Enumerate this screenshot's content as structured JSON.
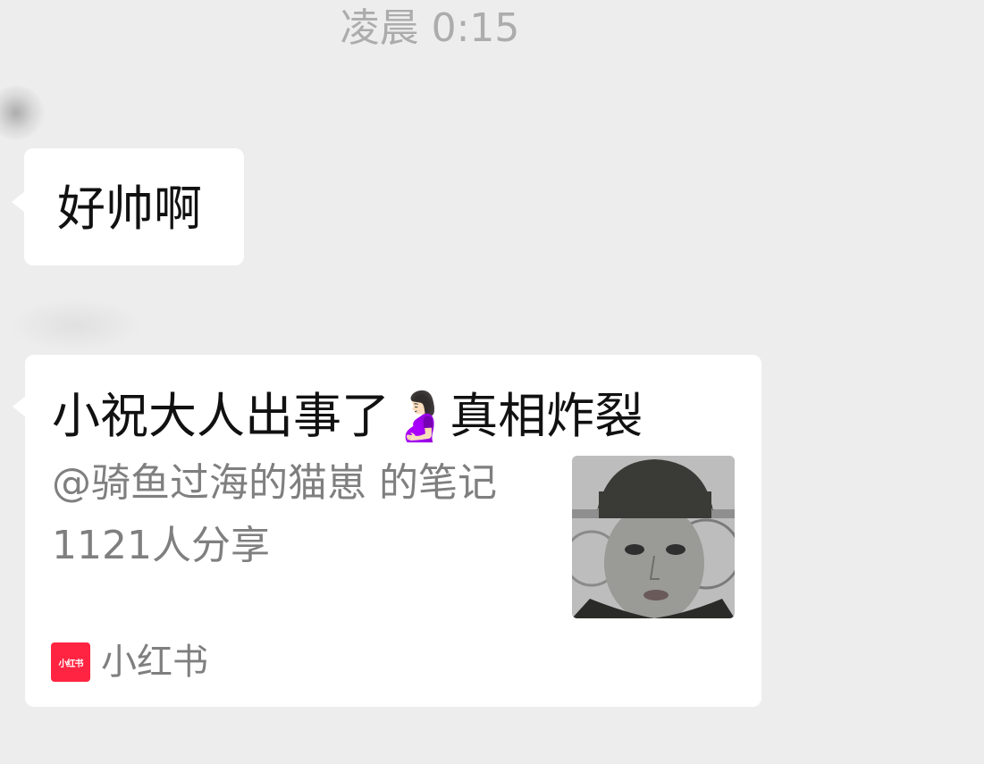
{
  "timestamp": "凌晨 0:15",
  "messages": [
    {
      "type": "text",
      "text": "好帅啊"
    },
    {
      "type": "link_card",
      "title": "小祝大人出事了🤰🏻真相炸裂",
      "author_line": "@骑鱼过海的猫崽 的笔记",
      "shares_line": "1121人分享",
      "thumbnail": "portrait-thumbnail",
      "source": {
        "logo_text": "小红书",
        "name": "小红书",
        "logo_color": "#ff2442"
      }
    }
  ],
  "colors": {
    "background": "#ededed",
    "bubble": "#ffffff",
    "secondary_text": "#7f7f7f",
    "timestamp_text": "#acacac"
  }
}
